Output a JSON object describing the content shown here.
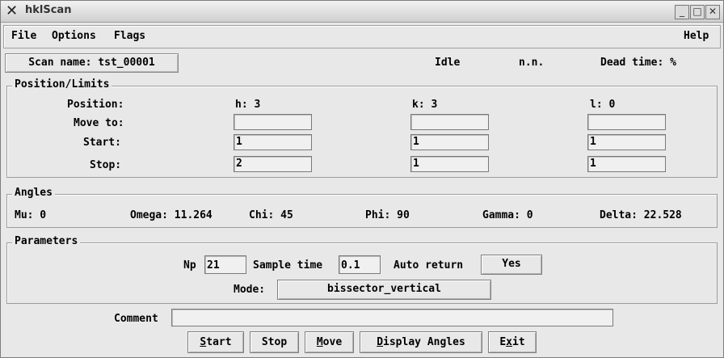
{
  "window": {
    "title": "hklScan"
  },
  "menubar": {
    "file": "File",
    "options": "Options",
    "flags": "Flags",
    "help": "Help"
  },
  "status": {
    "scan_name": "Scan name: tst_00001",
    "state": "Idle",
    "nn": "n.n.",
    "dead_time": "Dead time: %"
  },
  "position": {
    "group_label": "Position/Limits",
    "row_labels": {
      "position": "Position:",
      "move_to": "Move to:",
      "start": "Start:",
      "stop": "Stop:"
    },
    "h": {
      "current": "h: 3",
      "move_to": "",
      "start": "1",
      "stop": "2"
    },
    "k": {
      "current": "k: 3",
      "move_to": "",
      "start": "1",
      "stop": "1"
    },
    "l": {
      "current": "l: 0",
      "move_to": "",
      "start": "1",
      "stop": "1"
    }
  },
  "angles": {
    "group_label": "Angles",
    "mu": "Mu: 0",
    "omega": "Omega: 11.264",
    "chi": "Chi: 45",
    "phi": "Phi: 90",
    "gamma": "Gamma: 0",
    "delta": "Delta: 22.528"
  },
  "parameters": {
    "group_label": "Parameters",
    "np_label": "Np",
    "np_value": "21",
    "sample_time_label": "Sample time",
    "sample_time_value": "0.1",
    "auto_return_label": "Auto return",
    "auto_return_value": "Yes",
    "mode_label": "Mode:",
    "mode_value": "bissector_vertical"
  },
  "comment": {
    "label": "Comment",
    "value": ""
  },
  "buttons": {
    "start_pre": "",
    "start_mn": "S",
    "start_post": "tart",
    "stop": "Stop",
    "move_pre": "",
    "move_mn": "M",
    "move_post": "ove",
    "display_pre": "",
    "display_mn": "D",
    "display_post": "isplay Angles",
    "exit_pre": "E",
    "exit_mn": "x",
    "exit_post": "it"
  }
}
